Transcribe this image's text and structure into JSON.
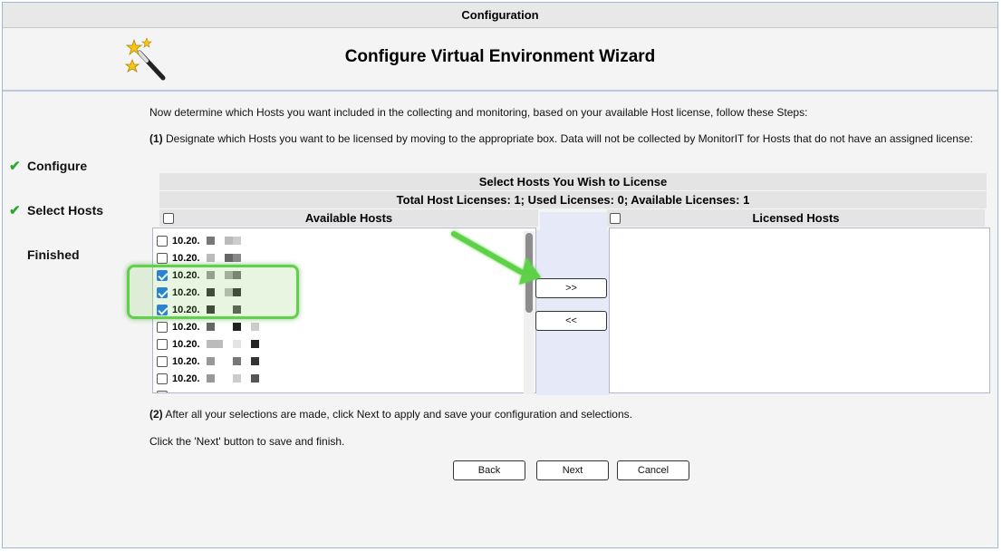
{
  "window": {
    "title": "Configuration"
  },
  "wizard": {
    "title": "Configure Virtual Environment Wizard",
    "icon": "magic-wand-icon"
  },
  "steps": [
    {
      "label": "Configure",
      "done": true
    },
    {
      "label": "Select Hosts",
      "done": true
    },
    {
      "label": "Finished",
      "done": false
    }
  ],
  "instructions": {
    "intro": "Now determine which Hosts you want included in the collecting and monitoring, based on your available Host license, follow these Steps:",
    "step1_num": "(1)",
    "step1": "Designate which Hosts you want to be licensed by moving to the appropriate box. Data will not be collected by MonitorIT for Hosts that do not have an assigned license:",
    "step2_num": "(2)",
    "step2": "After all your selections are made, click Next to apply and save your configuration and selections.",
    "finish": "Click the 'Next' button to save and finish."
  },
  "license_panel": {
    "title": "Select Hosts You Wish to License",
    "summary": "Total Host Licenses: 1;   Used Licenses: 0;   Available Licenses: 1",
    "available_header": "Available Hosts",
    "licensed_header": "Licensed Hosts",
    "available_hosts": [
      {
        "label": "10.20.",
        "checked": false
      },
      {
        "label": "10.20.",
        "checked": false
      },
      {
        "label": "10.20.",
        "checked": true
      },
      {
        "label": "10.20.",
        "checked": true
      },
      {
        "label": "10.20.",
        "checked": true
      },
      {
        "label": "10.20.",
        "checked": false
      },
      {
        "label": "10.20.",
        "checked": false
      },
      {
        "label": "10.20.",
        "checked": false
      },
      {
        "label": "10.20.",
        "checked": false
      }
    ],
    "licensed_hosts": [],
    "move_right_label": ">>",
    "move_left_label": "<<"
  },
  "buttons": {
    "back": "Back",
    "next": "Next",
    "cancel": "Cancel"
  },
  "colors": {
    "check": "#2fa52f",
    "highlight": "#5fd14a",
    "accent": "#1a73e8"
  }
}
